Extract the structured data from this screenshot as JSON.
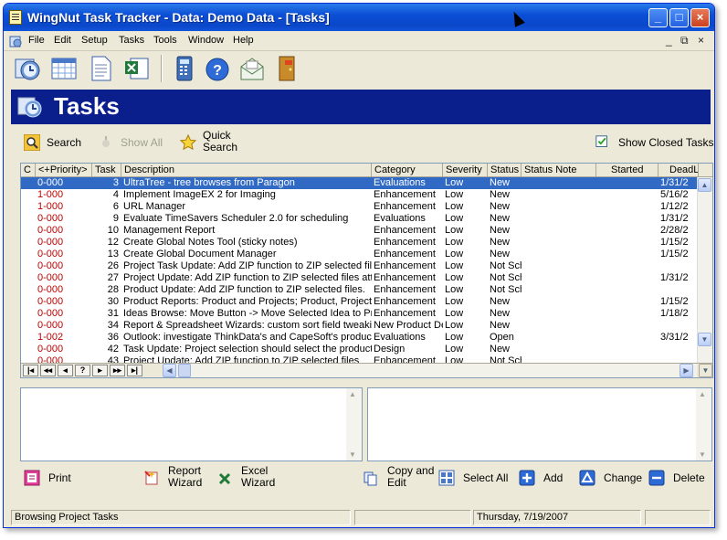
{
  "window": {
    "title": "WingNut Task Tracker -   Data: Demo Data - [Tasks]"
  },
  "menu": [
    "File",
    "Edit",
    "Setup",
    "Tasks",
    "Tools",
    "Window",
    "Help"
  ],
  "banner": {
    "title": "Tasks"
  },
  "search": {
    "search_label": "Search",
    "show_all_label": "Show All",
    "quick_search_line1": "Quick",
    "quick_search_line2": "Search",
    "show_closed_label": "Show Closed Tasks",
    "show_closed_checked": true
  },
  "grid": {
    "columns": [
      "C",
      "<+Priority>",
      "Task",
      "Description",
      "Category",
      "Severity",
      "Status",
      "Status Note",
      "Started",
      "DeadL"
    ],
    "rows": [
      [
        "",
        "0-000",
        "3",
        "UltraTree - tree browses from Paragon",
        "Evaluations",
        "Low",
        "New",
        "",
        "",
        "1/31/2"
      ],
      [
        "",
        "1-000",
        "4",
        "Implement ImageEX 2 for Imaging",
        "Enhancement",
        "Low",
        "New",
        "",
        "",
        "5/16/2"
      ],
      [
        "",
        "1-000",
        "6",
        "URL Manager",
        "Enhancement",
        "Low",
        "New",
        "",
        "",
        "1/12/2"
      ],
      [
        "",
        "0-000",
        "9",
        "Evaluate TimeSavers Scheduler 2.0 for scheduling",
        "Evaluations",
        "Low",
        "New",
        "",
        "",
        "1/31/2"
      ],
      [
        "",
        "0-000",
        "10",
        "Management Report",
        "Enhancement",
        "Low",
        "New",
        "",
        "",
        "2/28/2"
      ],
      [
        "",
        "0-000",
        "12",
        "Create Global Notes Tool (sticky notes)",
        "Enhancement",
        "Low",
        "New",
        "",
        "",
        "1/15/2"
      ],
      [
        "",
        "0-000",
        "13",
        "Create Global Document Manager",
        "Enhancement",
        "Low",
        "New",
        "",
        "",
        "1/15/2"
      ],
      [
        "",
        "0-000",
        "26",
        "Project Task Update: Add ZIP function to ZIP selected files",
        "Enhancement",
        "Low",
        "Not Sch",
        "",
        "",
        ""
      ],
      [
        "",
        "0-000",
        "27",
        "Project Update: Add ZIP function to ZIP selected files attached",
        "Enhancement",
        "Low",
        "Not Sch",
        "",
        "",
        "1/31/2"
      ],
      [
        "",
        "0-000",
        "28",
        "Product Update: Add ZIP function to ZIP selected files.",
        "Enhancement",
        "Low",
        "Not Sch",
        "",
        "",
        ""
      ],
      [
        "",
        "0-000",
        "30",
        "Product Reports: Product and Projects; Product, Projects",
        "Enhancement",
        "Low",
        "New",
        "",
        "",
        "1/15/2"
      ],
      [
        "",
        "0-000",
        "31",
        "Ideas Browse: Move Button -> Move Selected Idea to Project",
        "Enhancement",
        "Low",
        "New",
        "",
        "",
        "1/18/2"
      ],
      [
        "",
        "0-000",
        "34",
        "Report & Spreadsheet Wizards: custom sort field tweaking",
        "New Product Dev",
        "Low",
        "New",
        "",
        "",
        ""
      ],
      [
        "",
        "1-002",
        "36",
        "Outlook: investigate ThinkData's and CapeSoft's products",
        "Evaluations",
        "Low",
        "Open",
        "",
        "",
        "3/31/2"
      ],
      [
        "",
        "0-000",
        "42",
        "Task Update: Project selection should select the product",
        "Design",
        "Low",
        "New",
        "",
        "",
        ""
      ],
      [
        "",
        "0-000",
        "43",
        "Project Update: Add ZIP function to ZIP selected files",
        "Enhancement",
        "Low",
        "Not Sch",
        "",
        "",
        ""
      ]
    ],
    "nav_buttons": [
      "|◂",
      "◂◂",
      "◂",
      "?",
      "▸",
      "▸▸",
      "▸|"
    ]
  },
  "actions": {
    "print": "Print",
    "report_wizard_1": "Report",
    "report_wizard_2": "Wizard",
    "excel_wizard_1": "Excel",
    "excel_wizard_2": "Wizard",
    "copy_edit_1": "Copy and",
    "copy_edit_2": "Edit",
    "select_all": "Select All",
    "add": "Add",
    "change": "Change",
    "delete": "Delete"
  },
  "status": {
    "message": "Browsing Project Tasks",
    "date": "Thursday,  7/19/2007"
  },
  "colors": {
    "banner": "#0a1e8c",
    "selection": "#316ac5",
    "priority": "#c00000"
  }
}
